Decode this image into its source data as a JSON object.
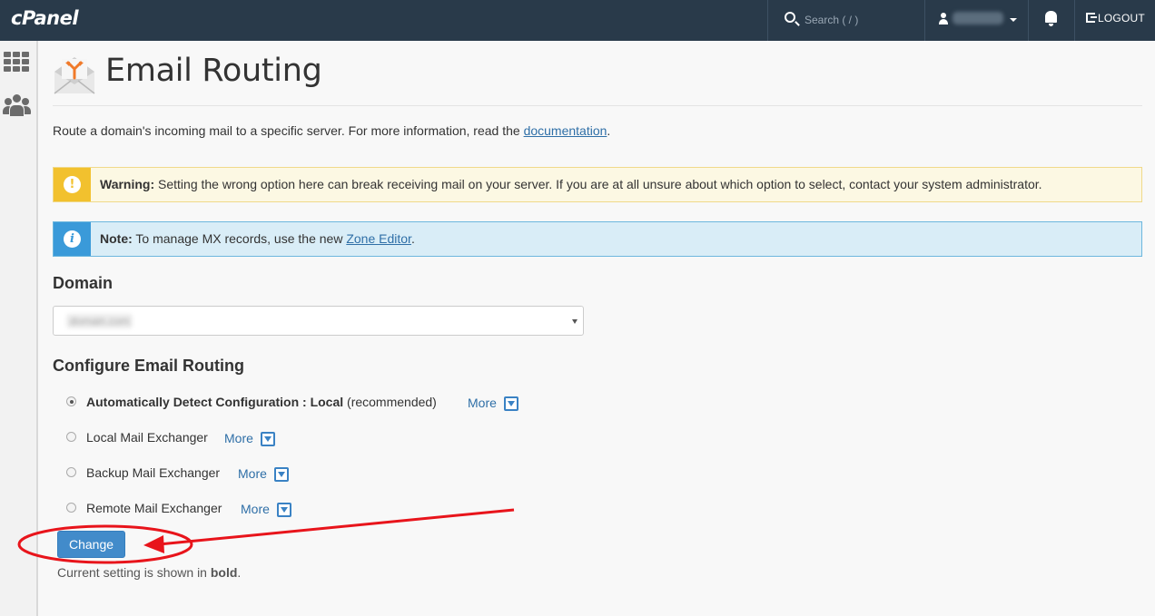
{
  "header": {
    "logo": "cPanel",
    "search_placeholder": "Search ( / )",
    "username": "username",
    "logout_label": "LOGOUT"
  },
  "sidebar": {
    "items": [
      {
        "icon": "grid-icon"
      },
      {
        "icon": "users-icon"
      }
    ]
  },
  "page": {
    "title": "Email Routing",
    "intro_text": "Route a domain's incoming mail to a specific server. For more information, read the ",
    "intro_link": "documentation",
    "intro_end": "."
  },
  "warning": {
    "label": "Warning:",
    "text": " Setting the wrong option here can break receiving mail on your server. If you are at all unsure about which option to select, contact your system administrator.",
    "icon": "!"
  },
  "note": {
    "label": "Note:",
    "text": " To manage MX records, use the new ",
    "link": "Zone Editor",
    "end": ".",
    "icon": "i"
  },
  "domain": {
    "heading": "Domain",
    "selected": "domain.com"
  },
  "routing": {
    "heading": "Configure Email Routing",
    "options": [
      {
        "label": "Automatically Detect Configuration : Local",
        "suffix": " (recommended)",
        "more": "More",
        "selected": true
      },
      {
        "label": "Local Mail Exchanger",
        "more": "More",
        "selected": false
      },
      {
        "label": "Backup Mail Exchanger",
        "more": "More",
        "selected": false
      },
      {
        "label": "Remote Mail Exchanger",
        "more": "More",
        "selected": false
      }
    ],
    "button": "Change",
    "current_prefix": "Current setting is shown in ",
    "current_bold": "bold",
    "current_end": "."
  },
  "colors": {
    "topbar": "#293a4a",
    "primary": "#428bca",
    "warning": "#f2c12e",
    "info": "#3a9ad9",
    "annotation": "#e8141b"
  }
}
